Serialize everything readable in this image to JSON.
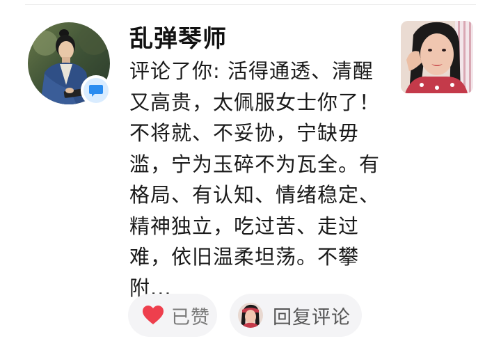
{
  "notification": {
    "username": "乱弹琴师",
    "comment": "评论了你: 活得通透、清醒又高贵，太佩服女士你了！不将就、不妥协，宁缺毋滥，宁为玉碎不为瓦全。有格局、有认知、情绪稳定、精神独立，吃过苦、走过难，依旧温柔坦荡。不攀附...",
    "avatar_icon": "man-in-blue-robe-avatar",
    "badge_icon": "comment-bubble-icon",
    "thumbnail_icon": "woman-selfie-thumbnail"
  },
  "actions": {
    "like_label": "已赞",
    "like_icon": "heart-icon",
    "like_color": "#ee3f4d",
    "reply_label": "回复评论",
    "reply_avatar_icon": "user-avatar-icon"
  },
  "colors": {
    "badge_blue": "#2a8cf0",
    "badge_bg": "#d9ecff",
    "button_bg": "#f4f4f6"
  }
}
